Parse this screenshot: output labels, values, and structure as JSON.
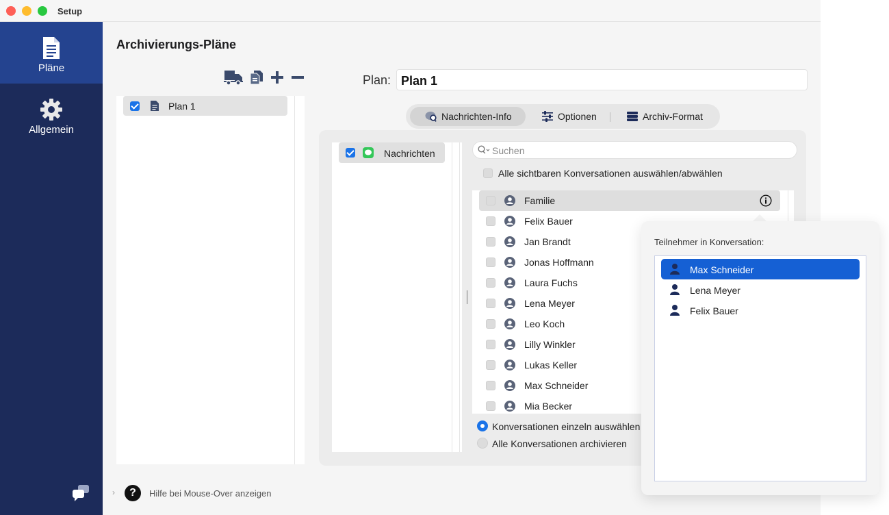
{
  "window": {
    "title": "Setup"
  },
  "sidebar": {
    "items": [
      {
        "label": "Pläne",
        "icon": "document-icon",
        "active": true
      },
      {
        "label": "Allgemein",
        "icon": "gear-icon",
        "active": false
      }
    ],
    "feedback_icon": "chat-bubbles-icon"
  },
  "main": {
    "title": "Archivierungs-Pläne",
    "toolbar": [
      "truck-icon",
      "duplicate-icon",
      "plus-icon",
      "minus-icon"
    ],
    "plans": [
      {
        "label": "Plan 1",
        "checked": true
      }
    ],
    "plan_field": {
      "label": "Plan:",
      "value": "Plan 1"
    },
    "tabs": [
      {
        "label": "Nachrichten-Info",
        "icon": "message-search-icon",
        "active": true
      },
      {
        "label": "Optionen",
        "icon": "sliders-icon",
        "active": false
      },
      {
        "label": "Archiv-Format",
        "icon": "database-icon",
        "active": false
      }
    ],
    "sources": [
      {
        "label": "Nachrichten",
        "checked": true,
        "icon": "messages-app-icon"
      }
    ],
    "search": {
      "placeholder": "Suchen",
      "value": ""
    },
    "select_all_label": "Alle sichtbaren Konversationen auswählen/abwählen",
    "conversations": [
      "Familie",
      "Felix Bauer",
      "Jan Brandt",
      "Jonas Hoffmann",
      "Laura Fuchs",
      "Lena Meyer",
      "Leo Koch",
      "Lilly Winkler",
      "Lukas Keller",
      "Max Schneider",
      "Mia Becker"
    ],
    "selected_conversation": "Familie",
    "mode_options": [
      {
        "label": "Konversationen einzeln auswählen",
        "selected": true
      },
      {
        "label": "Alle Konversationen archivieren",
        "selected": false
      }
    ]
  },
  "popover": {
    "title": "Teilnehmer in Konversation:",
    "participants": [
      "Max Schneider",
      "Lena Meyer",
      "Felix Bauer"
    ],
    "selected": "Max Schneider"
  },
  "footer": {
    "help_label": "Hilfe bei Mouse-Over anzeigen",
    "help_glyph": "?"
  },
  "colors": {
    "sidebar": "#1c2b5a",
    "sidebar_active": "#24438f",
    "accent": "#1a73e8",
    "selection": "#1560d4"
  }
}
